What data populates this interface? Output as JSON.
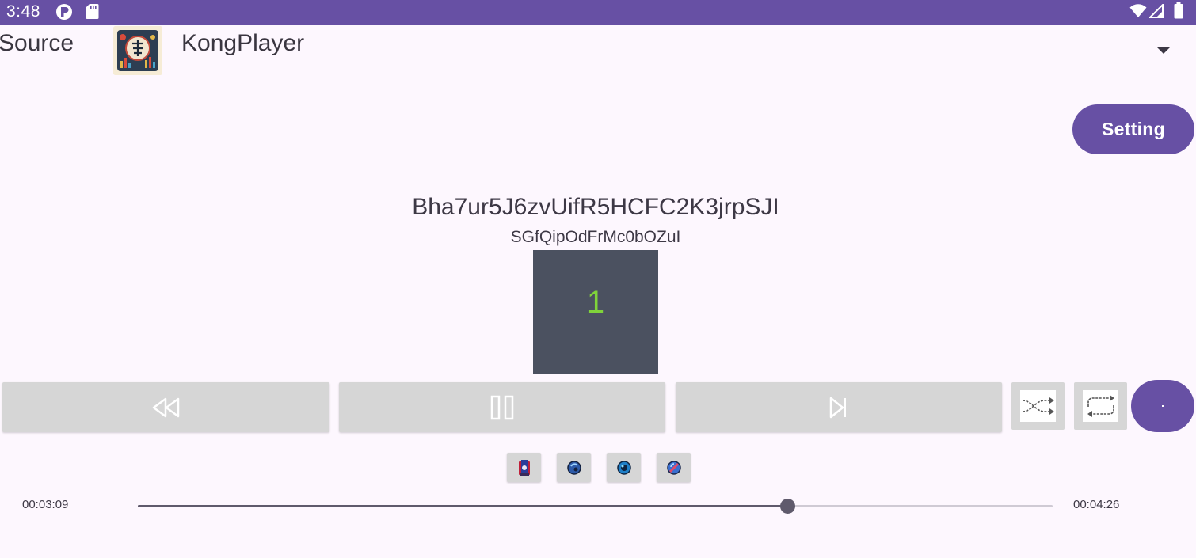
{
  "status_bar": {
    "time": "3:48",
    "background": "#6750a4",
    "icons": [
      "notification-badge-icon",
      "sd-card-icon",
      "wifi-icon",
      "signal-icon",
      "battery-icon"
    ]
  },
  "header": {
    "source_label": "Source",
    "app_title": "KongPlayer",
    "logo_icon": "app-logo-icon",
    "dropdown_icon": "dropdown-arrow-icon"
  },
  "setting_button": {
    "label": "Setting"
  },
  "track": {
    "title": "Bha7ur5J6zvUifR5HCFC2K3jrpSJI",
    "subtitle": "SGfQipOdFrMc0bOZuI",
    "cover_number": "1"
  },
  "controls": {
    "rewind_icon": "rewind-icon",
    "pause_icon": "pause-icon",
    "next_icon": "skip-next-icon",
    "shuffle_icon": "shuffle-icon",
    "repeat_icon": "repeat-icon",
    "round_button_color": "#6750a4"
  },
  "effects": [
    {
      "icon": "effect-1-icon"
    },
    {
      "icon": "effect-2-icon"
    },
    {
      "icon": "effect-3-icon"
    },
    {
      "icon": "effect-4-icon"
    }
  ],
  "progress": {
    "elapsed": "00:03:09",
    "total": "00:04:26",
    "fraction": 0.711
  },
  "colors": {
    "accent": "#6750a4",
    "cover_bg": "#4b5160",
    "cover_number": "#7fd33a",
    "button_gray": "#d6d6d6"
  }
}
